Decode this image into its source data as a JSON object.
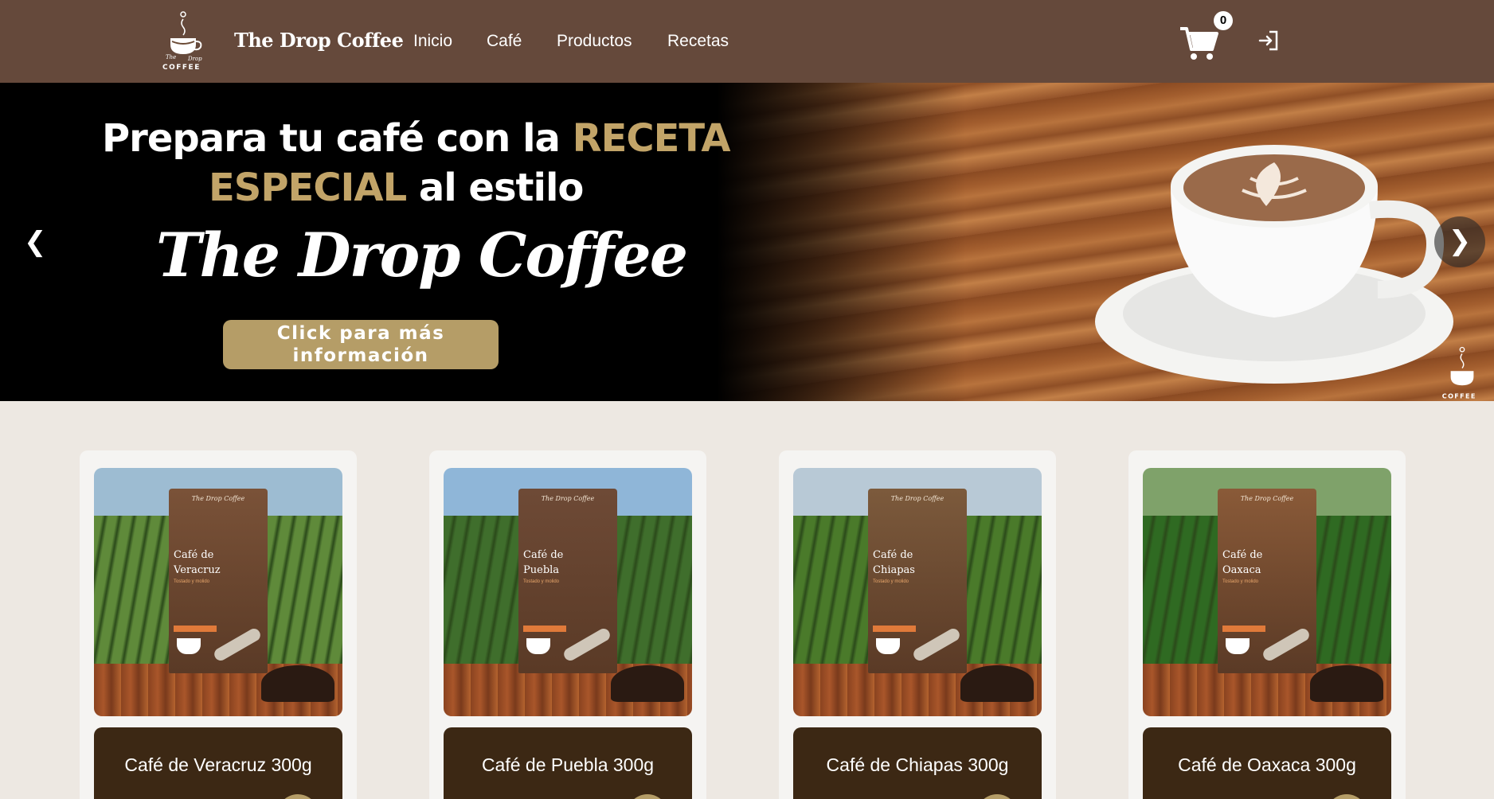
{
  "navbar": {
    "brand": "The Drop Coffee",
    "links": [
      "Inicio",
      "Café",
      "Productos",
      "Recetas"
    ],
    "cart_count": "0",
    "logo_text_top": "The",
    "logo_text_right": "Drop",
    "logo_text_bottom": "COFFEE",
    "bg_color": "#65493b"
  },
  "hero": {
    "line1_white": "Prepara tu café con la ",
    "line1_gold": "RECETA",
    "line2_gold": "ESPECIAL",
    "line2_white": " al estilo",
    "title": "The Drop Coffee",
    "button_line1": "Click para más",
    "button_line2": "información",
    "prev": "❮",
    "next": "❯",
    "accent_color": "#c2a468"
  },
  "products": [
    {
      "name": "Café de Veracruz 300g",
      "bag_name_line1": "Café de",
      "bag_name_line2": "Veracruz",
      "bag_brand": "The Drop Coffee",
      "bag_subtitle": "Tostado y molido",
      "bag_color": "#7a5238",
      "field_color": "#5f8a3a",
      "sky_color": "#9dbcd2"
    },
    {
      "name": "Café de Puebla 300g",
      "bag_name_line1": "Café de",
      "bag_name_line2": "Puebla",
      "bag_brand": "The Drop Coffee",
      "bag_subtitle": "Tostado y molido",
      "bag_color": "#6e4a36",
      "field_color": "#3f6e2c",
      "sky_color": "#8fb6d8"
    },
    {
      "name": "Café de Chiapas 300g",
      "bag_name_line1": "Café de",
      "bag_name_line2": "Chiapas",
      "bag_brand": "The Drop Coffee",
      "bag_subtitle": "Tostado y molido",
      "bag_color": "#7c5a3c",
      "field_color": "#4a7a2a",
      "sky_color": "#b8c9d6"
    },
    {
      "name": "Café de Oaxaca 300g",
      "bag_name_line1": "Café de",
      "bag_name_line2": "Oaxaca",
      "bag_brand": "The Drop Coffee",
      "bag_subtitle": "Tostado y molido",
      "bag_color": "#8a5a38",
      "field_color": "#2f6a22",
      "sky_color": "#7fa26a"
    }
  ]
}
